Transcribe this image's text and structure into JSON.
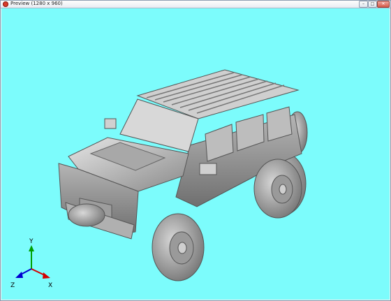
{
  "window": {
    "title": "Preview (1280 x 960)",
    "icon": "app-icon",
    "controls": {
      "minimize": "–",
      "maximize": "□",
      "close": "✕"
    }
  },
  "viewport": {
    "background": "#7cfcfc",
    "model": "off-road-suv-3d-model",
    "axes": {
      "x_label": "X",
      "y_label": "Y",
      "z_label": "Z"
    },
    "axis_colors": {
      "x": "#d40000",
      "y": "#00a000",
      "z": "#0000d0"
    }
  }
}
